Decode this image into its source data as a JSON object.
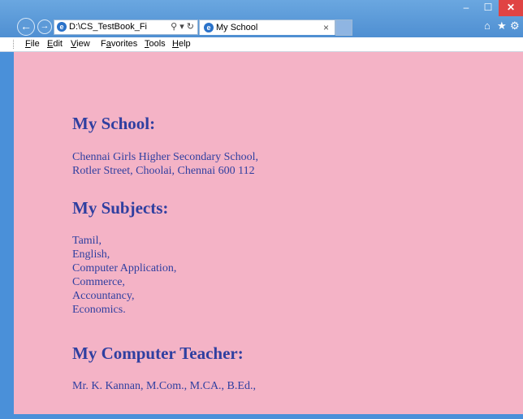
{
  "window": {
    "min_label": "–",
    "max_label": "☐",
    "close_label": "✕"
  },
  "nav": {
    "back_glyph": "←",
    "forward_glyph": "→"
  },
  "address": {
    "url": "D:\\CS_TestBook_Final\\",
    "tools": "⚲ ▾ ↻"
  },
  "tab": {
    "title": "My School",
    "close": "×"
  },
  "toolbar_icons": {
    "home": "⌂",
    "favorites": "★",
    "settings": "⚙"
  },
  "menu": {
    "file": {
      "acc": "F",
      "rest": "ile"
    },
    "edit": {
      "acc": "E",
      "rest": "dit"
    },
    "view": {
      "acc": "V",
      "rest": "iew"
    },
    "favorites": {
      "pre": "F",
      "acc": "a",
      "rest": "vorites"
    },
    "tools": {
      "acc": "T",
      "rest": "ools"
    },
    "help": {
      "acc": "H",
      "rest": "elp"
    }
  },
  "page": {
    "school_heading": "My School:",
    "school_lines": [
      "Chennai Girls Higher Secondary School,",
      "Rotler Street, Choolai, Chennai 600 112"
    ],
    "subjects_heading": "My Subjects:",
    "subjects": [
      "Tamil,",
      "English,",
      "Computer Application,",
      "Commerce,",
      "Accountancy,",
      "Economics."
    ],
    "teacher_heading": "My Computer Teacher:",
    "teacher": "Mr. K. Kannan, M.Com., M.CA., B.Ed.,"
  },
  "colors": {
    "page_background": "#f4b3c6",
    "text": "#2f3fa0",
    "chrome": "#4f8fd2",
    "close_button": "#e04343"
  }
}
